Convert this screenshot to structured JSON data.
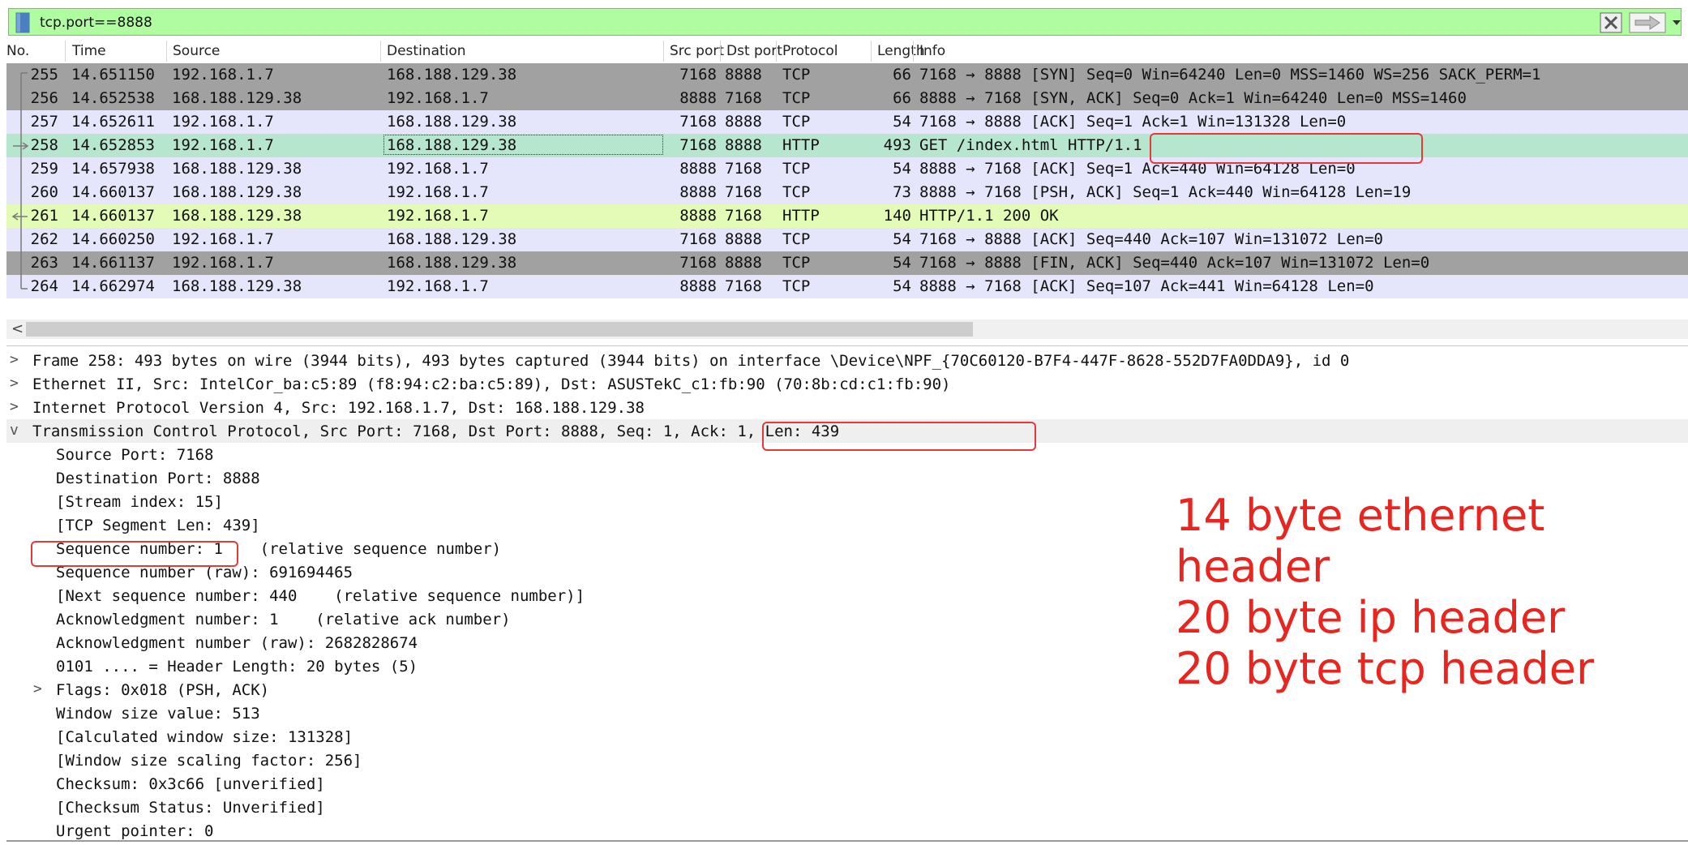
{
  "filter": {
    "value": "tcp.port==8888",
    "background": "#b0fca0"
  },
  "columns": [
    "No.",
    "Time",
    "Source",
    "Destination",
    "Src port",
    "Dst port",
    "Protocol",
    "Length",
    "Info"
  ],
  "packets": [
    {
      "no": "255",
      "time": "14.651150",
      "src": "192.168.1.7",
      "dst": "168.188.129.38",
      "sport": "7168",
      "dport": "8888",
      "proto": "TCP",
      "len": "66",
      "info": "7168 → 8888 [SYN] Seq=0 Win=64240 Len=0 MSS=1460 WS=256 SACK_PERM=1",
      "color": "gray"
    },
    {
      "no": "256",
      "time": "14.652538",
      "src": "168.188.129.38",
      "dst": "192.168.1.7",
      "sport": "8888",
      "dport": "7168",
      "proto": "TCP",
      "len": "66",
      "info": "8888 → 7168 [SYN, ACK] Seq=0 Ack=1 Win=64240 Len=0 MSS=1460",
      "color": "gray"
    },
    {
      "no": "257",
      "time": "14.652611",
      "src": "192.168.1.7",
      "dst": "168.188.129.38",
      "sport": "7168",
      "dport": "8888",
      "proto": "TCP",
      "len": "54",
      "info": "7168 → 8888 [ACK] Seq=1 Ack=1 Win=131328 Len=0",
      "color": "lav"
    },
    {
      "no": "258",
      "time": "14.652853",
      "src": "192.168.1.7",
      "dst": "168.188.129.38",
      "sport": "7168",
      "dport": "8888",
      "proto": "HTTP",
      "len": "493",
      "info": "GET /index.html HTTP/1.1",
      "color": "green"
    },
    {
      "no": "259",
      "time": "14.657938",
      "src": "168.188.129.38",
      "dst": "192.168.1.7",
      "sport": "8888",
      "dport": "7168",
      "proto": "TCP",
      "len": "54",
      "info": "8888 → 7168 [ACK] Seq=1 Ack=440 Win=64128 Len=0",
      "color": "lav"
    },
    {
      "no": "260",
      "time": "14.660137",
      "src": "168.188.129.38",
      "dst": "192.168.1.7",
      "sport": "8888",
      "dport": "7168",
      "proto": "TCP",
      "len": "73",
      "info": "8888 → 7168 [PSH, ACK] Seq=1 Ack=440 Win=64128 Len=19",
      "color": "lav"
    },
    {
      "no": "261",
      "time": "14.660137",
      "src": "168.188.129.38",
      "dst": "192.168.1.7",
      "sport": "8888",
      "dport": "7168",
      "proto": "HTTP",
      "len": "140",
      "info": "HTTP/1.1 200 OK",
      "color": "yellow"
    },
    {
      "no": "262",
      "time": "14.660250",
      "src": "192.168.1.7",
      "dst": "168.188.129.38",
      "sport": "7168",
      "dport": "8888",
      "proto": "TCP",
      "len": "54",
      "info": "7168 → 8888 [ACK] Seq=440 Ack=107 Win=131072 Len=0",
      "color": "lav"
    },
    {
      "no": "263",
      "time": "14.661137",
      "src": "192.168.1.7",
      "dst": "168.188.129.38",
      "sport": "7168",
      "dport": "8888",
      "proto": "TCP",
      "len": "54",
      "info": "7168 → 8888 [FIN, ACK] Seq=440 Ack=107 Win=131072 Len=0",
      "color": "gray"
    },
    {
      "no": "264",
      "time": "14.662974",
      "src": "168.188.129.38",
      "dst": "192.168.1.7",
      "sport": "8888",
      "dport": "7168",
      "proto": "TCP",
      "len": "54",
      "info": "8888 → 7168 [ACK] Seq=107 Ack=441 Win=64128 Len=0",
      "color": "lav"
    }
  ],
  "details": [
    {
      "arrow": ">",
      "indent": 0,
      "text": "Frame 258: 493 bytes on wire (3944 bits), 493 bytes captured (3944 bits) on interface \\Device\\NPF_{70C60120-B7F4-447F-8628-552D7FA0DDA9}, id 0"
    },
    {
      "arrow": ">",
      "indent": 0,
      "text": "Ethernet II, Src: IntelCor_ba:c5:89 (f8:94:c2:ba:c5:89), Dst: ASUSTekC_c1:fb:90 (70:8b:cd:c1:fb:90)"
    },
    {
      "arrow": ">",
      "indent": 0,
      "text": "Internet Protocol Version 4, Src: 192.168.1.7, Dst: 168.188.129.38"
    },
    {
      "arrow": "v",
      "indent": 0,
      "text": "Transmission Control Protocol, Src Port: 7168, Dst Port: 8888, Seq: 1, Ack: 1, Len: 439"
    },
    {
      "arrow": "",
      "indent": 1,
      "text": "Source Port: 7168"
    },
    {
      "arrow": "",
      "indent": 1,
      "text": "Destination Port: 8888"
    },
    {
      "arrow": "",
      "indent": 1,
      "text": "[Stream index: 15]"
    },
    {
      "arrow": "",
      "indent": 1,
      "text": "[TCP Segment Len: 439]"
    },
    {
      "arrow": "",
      "indent": 1,
      "text": "Sequence number: 1    (relative sequence number)"
    },
    {
      "arrow": "",
      "indent": 1,
      "text": "Sequence number (raw): 691694465"
    },
    {
      "arrow": "",
      "indent": 1,
      "text": "[Next sequence number: 440    (relative sequence number)]"
    },
    {
      "arrow": "",
      "indent": 1,
      "text": "Acknowledgment number: 1    (relative ack number)"
    },
    {
      "arrow": "",
      "indent": 1,
      "text": "Acknowledgment number (raw): 2682828674"
    },
    {
      "arrow": "",
      "indent": 1,
      "text": "0101 .... = Header Length: 20 bytes (5)"
    },
    {
      "arrow": ">",
      "indent": 1,
      "text": "Flags: 0x018 (PSH, ACK)"
    },
    {
      "arrow": "",
      "indent": 1,
      "text": "Window size value: 513"
    },
    {
      "arrow": "",
      "indent": 1,
      "text": "[Calculated window size: 131328]"
    },
    {
      "arrow": "",
      "indent": 1,
      "text": "[Window size scaling factor: 256]"
    },
    {
      "arrow": "",
      "indent": 1,
      "text": "Checksum: 0x3c66 [unverified]"
    },
    {
      "arrow": "",
      "indent": 1,
      "text": "[Checksum Status: Unverified]"
    },
    {
      "arrow": "",
      "indent": 1,
      "text": "Urgent pointer: 0"
    }
  ],
  "annotation": {
    "lines": [
      "14 byte ethernet header",
      "20 byte ip header",
      "20 byte tcp header"
    ],
    "color": "#e8251f"
  }
}
